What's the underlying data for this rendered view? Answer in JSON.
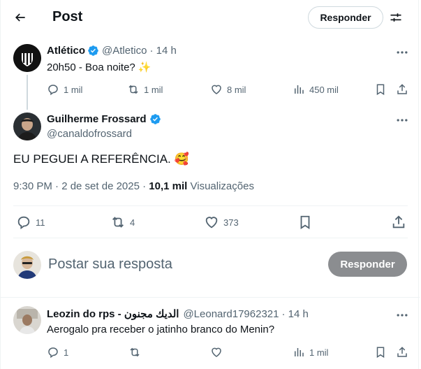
{
  "header": {
    "title": "Post",
    "reply_button": "Responder"
  },
  "parent_post": {
    "name": "Atlético",
    "handle": "@Atletico",
    "time": "· 14 h",
    "text": "20h50 - Boa noite? ✨",
    "replies": "1 mil",
    "reposts": "1 mil",
    "likes": "8 mil",
    "views": "450 mil"
  },
  "main_post": {
    "name": "Guilherme Frossard",
    "handle": "@canaldofrossard",
    "text": "EU PEGUEI A REFERÊNCIA. 🥰",
    "timestamp": "9:30 PM · 2 de set de 2025",
    "separator": "·",
    "views_count": "10,1 mil",
    "views_label": "Visualizações",
    "replies": "11",
    "reposts": "4",
    "likes": "373"
  },
  "compose": {
    "placeholder": "Postar sua resposta",
    "button": "Responder"
  },
  "reply": {
    "name": "Leozin do rps - الديك مجنون",
    "handle": "@Leonard17962321",
    "time": "· 14 h",
    "text": "Aerogalo pra receber o jatinho branco do Menin?",
    "replies": "1",
    "reposts": "",
    "likes": "",
    "views": "1 mil"
  },
  "colors": {
    "verified": "#1d9bf0",
    "muted": "#536471",
    "text": "#0f1419",
    "reply_button_disabled": "#8b8d90"
  }
}
